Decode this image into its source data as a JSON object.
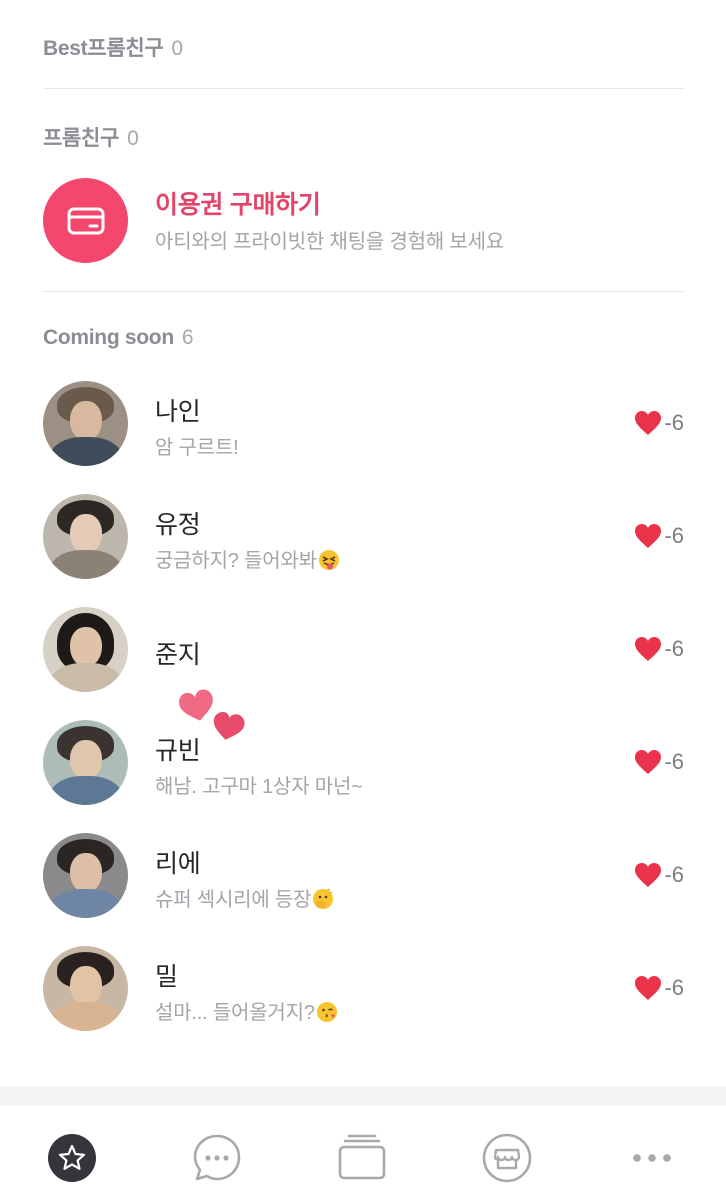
{
  "sections": {
    "best": {
      "title": "Best프롬친구",
      "count": "0"
    },
    "friends": {
      "title": "프롬친구",
      "count": "0"
    },
    "coming_soon": {
      "title": "Coming soon",
      "count": "6"
    }
  },
  "purchase": {
    "icon": "card-icon",
    "title": "이용권 구매하기",
    "subtitle": "아티와의 프라이빗한 채팅을 경험해 보세요"
  },
  "friends": [
    {
      "name": "나인",
      "message": "암 구르트!",
      "score": "-6"
    },
    {
      "name": "유정",
      "message": "궁금하지? 들어와봐",
      "emoji": "tongue-face-emoji",
      "score": "-6"
    },
    {
      "name": "준지",
      "message": "",
      "score": "-6"
    },
    {
      "name": "규빈",
      "message": "해남. 고구마 1상자 마넌~",
      "score": "-6"
    },
    {
      "name": "리에",
      "message": "슈퍼 섹시리에 등장",
      "emoji": "hand-over-mouth-emoji",
      "score": "-6"
    },
    {
      "name": "밀",
      "message": "설마... 들어올거지?",
      "emoji": "kissing-wink-emoji",
      "score": "-6"
    }
  ],
  "tabbar": {
    "tabs": [
      {
        "icon": "star-icon",
        "active": true
      },
      {
        "icon": "chat-bubble-icon",
        "active": false
      },
      {
        "icon": "cards-icon",
        "active": false
      },
      {
        "icon": "store-icon",
        "active": false
      },
      {
        "icon": "more-icon",
        "active": false
      }
    ]
  },
  "colors": {
    "accent": "#f4476d",
    "accent_text": "#e2456a",
    "heart": "#e8334a",
    "muted": "#a4a4ab"
  }
}
